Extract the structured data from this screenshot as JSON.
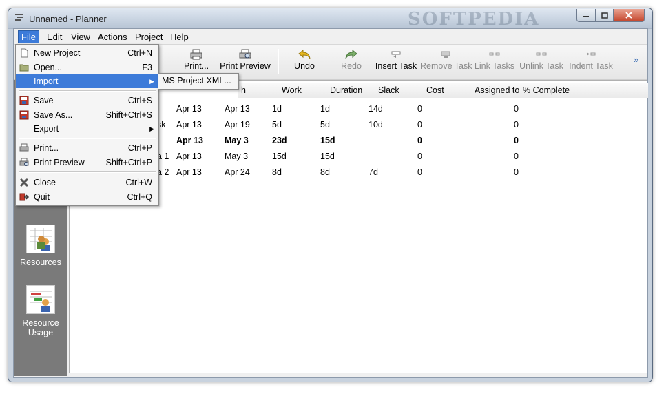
{
  "window": {
    "title": "Unnamed - Planner",
    "watermark": "SOFTPEDIA"
  },
  "menubar": {
    "items": [
      "File",
      "Edit",
      "View",
      "Actions",
      "Project",
      "Help"
    ],
    "active": "File"
  },
  "toolbar": {
    "items": [
      {
        "label": "Print...",
        "icon": "printer-icon",
        "enabled": true
      },
      {
        "label": "Print Preview",
        "icon": "print-preview-icon",
        "enabled": true
      },
      {
        "label": "Undo",
        "icon": "undo-icon",
        "enabled": true
      },
      {
        "label": "Redo",
        "icon": "redo-icon",
        "enabled": false
      },
      {
        "label": "Insert Task",
        "icon": "insert-task-icon",
        "enabled": true
      },
      {
        "label": "Remove Task",
        "icon": "remove-task-icon",
        "enabled": false
      },
      {
        "label": "Link Tasks",
        "icon": "link-tasks-icon",
        "enabled": false
      },
      {
        "label": "Unlink Task",
        "icon": "unlink-task-icon",
        "enabled": false
      },
      {
        "label": "Indent Task",
        "icon": "indent-task-icon",
        "enabled": false
      }
    ],
    "overflow": "»"
  },
  "sidebar": {
    "resources": "Resources",
    "resource_usage_1": "Resource",
    "resource_usage_2": "Usage"
  },
  "table": {
    "headers": [
      "h",
      "Work",
      "Duration",
      "Slack",
      "Cost",
      "Assigned to",
      "% Complete"
    ],
    "rows": [
      {
        "name": "",
        "start": "Apr 13",
        "finish": "Apr 13",
        "work": "1d",
        "duration": "1d",
        "slack": "14d",
        "cost": "0",
        "assigned": "",
        "complete": "0",
        "bold": false
      },
      {
        "name": "sk",
        "start": "Apr 13",
        "finish": "Apr 19",
        "work": "5d",
        "duration": "5d",
        "slack": "10d",
        "cost": "0",
        "assigned": "",
        "complete": "0",
        "bold": false
      },
      {
        "name": "",
        "start": "Apr 13",
        "finish": "May 3",
        "work": "23d",
        "duration": "15d",
        "slack": "",
        "cost": "0",
        "assigned": "",
        "complete": "0",
        "bold": true
      },
      {
        "name": "a 1",
        "start": "Apr 13",
        "finish": "May 3",
        "work": "15d",
        "duration": "15d",
        "slack": "",
        "cost": "0",
        "assigned": "",
        "complete": "0",
        "bold": false
      },
      {
        "name": "a 2",
        "start": "Apr 13",
        "finish": "Apr 24",
        "work": "8d",
        "duration": "8d",
        "slack": "7d",
        "cost": "0",
        "assigned": "",
        "complete": "0",
        "bold": false
      }
    ]
  },
  "file_menu": {
    "new_project": {
      "label": "New Project",
      "shortcut": "Ctrl+N"
    },
    "open": {
      "label": "Open...",
      "shortcut": "F3"
    },
    "import": {
      "label": "Import"
    },
    "save": {
      "label": "Save",
      "shortcut": "Ctrl+S"
    },
    "save_as": {
      "label": "Save As...",
      "shortcut": "Shift+Ctrl+S"
    },
    "export": {
      "label": "Export"
    },
    "print": {
      "label": "Print...",
      "shortcut": "Ctrl+P"
    },
    "print_preview": {
      "label": "Print Preview",
      "shortcut": "Shift+Ctrl+P"
    },
    "close": {
      "label": "Close",
      "shortcut": "Ctrl+W"
    },
    "quit": {
      "label": "Quit",
      "shortcut": "Ctrl+Q"
    }
  },
  "import_submenu": {
    "item": "MS Project XML..."
  },
  "colors": {
    "highlight": "#3d7bd9",
    "sidebar": "#7a7a7a"
  }
}
